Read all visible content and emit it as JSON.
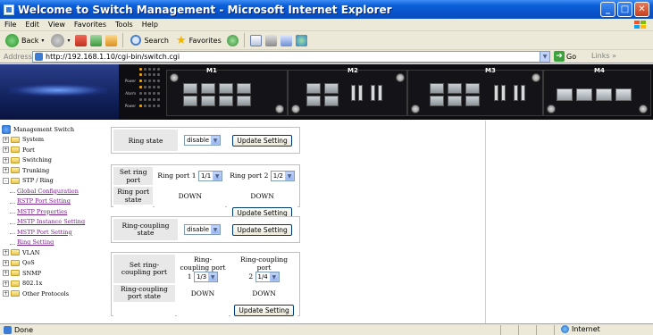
{
  "window": {
    "title": "Welcome to Switch Management - Microsoft Internet Explorer",
    "minimize": "_",
    "maximize": "□",
    "close": "✕"
  },
  "menu": [
    "File",
    "Edit",
    "View",
    "Favorites",
    "Tools",
    "Help"
  ],
  "toolbar": {
    "back": "Back",
    "search": "Search",
    "favorites": "Favorites"
  },
  "address": {
    "label": "Address",
    "url": "http://192.168.1.10/cgi-bin/switch.cgi",
    "go": "Go",
    "links": "Links"
  },
  "banner": {
    "modules": [
      "M1",
      "M2",
      "M3",
      "M4"
    ],
    "led_labels": [
      "Power",
      "Alarm",
      "Power"
    ]
  },
  "nav": {
    "root": "Management Switch",
    "items": [
      {
        "label": "System",
        "expander": "+"
      },
      {
        "label": "Port",
        "expander": "+"
      },
      {
        "label": "Switching",
        "expander": "+"
      },
      {
        "label": "Trunking",
        "expander": "+"
      },
      {
        "label": "STP / Ring",
        "expander": "-"
      }
    ],
    "stp_children": [
      "Global Configuration",
      "RSTP Port Setting",
      "MSTP Properties",
      "MSTP Instance Setting",
      "MSTP Port Setting",
      "Ring Setting"
    ],
    "items_after": [
      {
        "label": "VLAN",
        "expander": "+"
      },
      {
        "label": "QoS",
        "expander": "+"
      },
      {
        "label": "SNMP",
        "expander": "+"
      },
      {
        "label": "802.1x",
        "expander": "+"
      },
      {
        "label": "Other Protocols",
        "expander": "+"
      }
    ]
  },
  "form": {
    "ring_state": {
      "label": "Ring state",
      "value": "disable",
      "button": "Update Setting"
    },
    "ring_port": {
      "set_label": "Set ring port",
      "port1_label": "Ring port 1",
      "port1_value": "1/1",
      "port2_label": "Ring port 2",
      "port2_value": "1/2",
      "state_label": "Ring port state",
      "port1_state": "DOWN",
      "port2_state": "DOWN",
      "button": "Update Setting"
    },
    "ring_coupling_state": {
      "label": "Ring-coupling state",
      "value": "disable",
      "button": "Update Setting"
    },
    "ring_coupling_port": {
      "set_label": "Set ring-coupling port",
      "port1_label": "Ring-coupling port",
      "port1_num": "1",
      "port1_value": "1/3",
      "port2_label": "Ring-coupling port",
      "port2_num": "2",
      "port2_value": "1/4",
      "state_label": "Ring-coupling port state",
      "port1_state": "DOWN",
      "port2_state": "DOWN",
      "button": "Update Setting"
    }
  },
  "status": {
    "text": "Done",
    "zone": "Internet"
  }
}
